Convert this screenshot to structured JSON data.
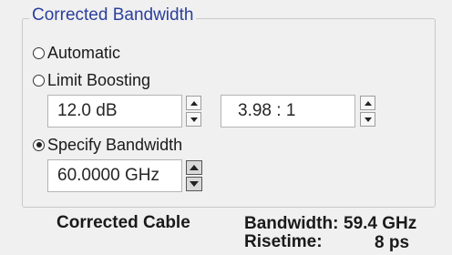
{
  "group": {
    "title": "Corrected Bandwidth"
  },
  "options": {
    "automatic": "Automatic",
    "limit_boosting": "Limit Boosting",
    "specify_bandwidth": "Specify Bandwidth",
    "selected": "specify_bandwidth"
  },
  "limit_boosting_fields": {
    "gain_value": "12.0 dB",
    "ratio_value": "3.98 : 1"
  },
  "specify_bandwidth_field": {
    "value": "60.0000 GHz"
  },
  "summary": {
    "label": "Corrected Cable",
    "bandwidth_label": "Bandwidth:",
    "bandwidth_value": "59.4 GHz",
    "risetime_label": "Risetime:",
    "risetime_value": "8 ps"
  },
  "icons": {
    "spinner": "up-down-arrows-icon",
    "radio": "radio-button-icon"
  },
  "colors": {
    "group_title": "#2b3f9c",
    "panel_background": "#f0f0f0"
  }
}
